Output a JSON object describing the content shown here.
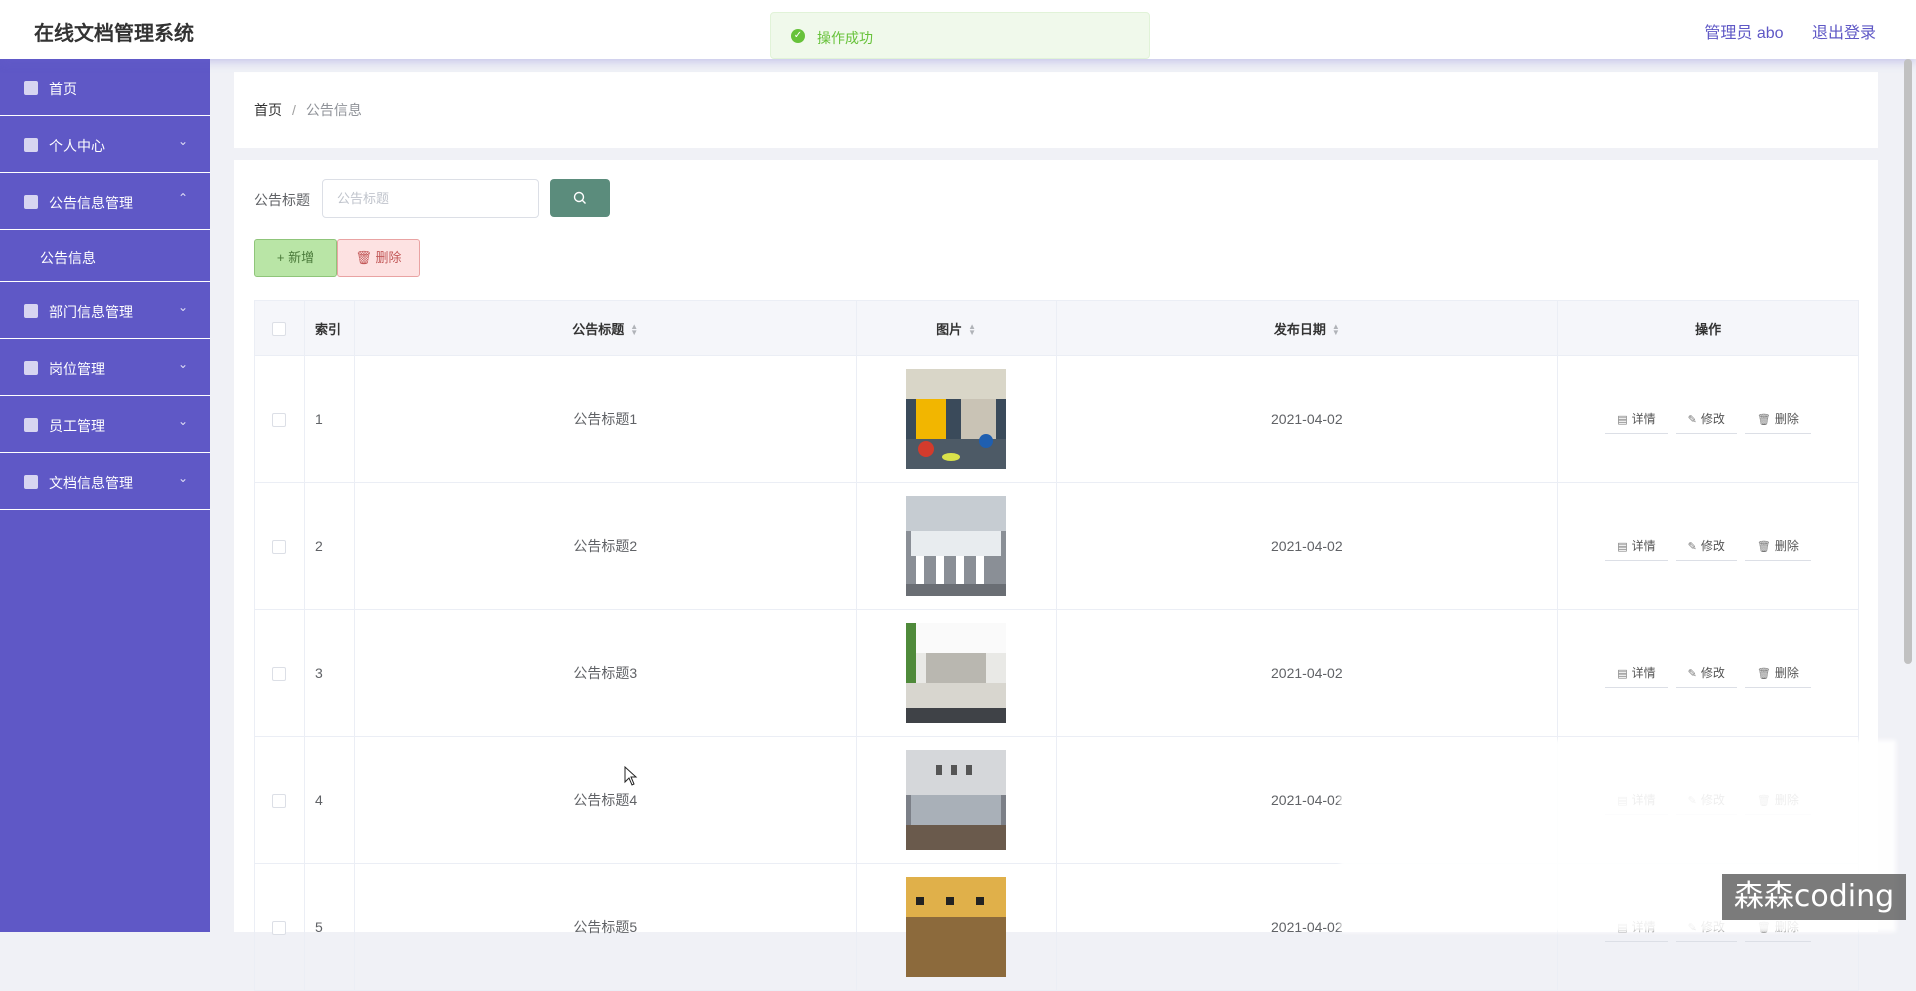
{
  "app": {
    "title": "在线文档管理系统"
  },
  "header": {
    "user_label": "管理员 abo",
    "logout_label": "退出登录"
  },
  "toast": {
    "message": "操作成功",
    "icon": "check-circle-icon",
    "color": "#67c23a"
  },
  "sidebar": {
    "items": [
      {
        "label": "首页",
        "icon": "home-icon"
      },
      {
        "label": "个人中心",
        "icon": "user-icon"
      },
      {
        "label": "公告信息管理",
        "icon": "chart-icon",
        "expanded": true,
        "children": [
          {
            "label": "公告信息"
          }
        ]
      },
      {
        "label": "部门信息管理",
        "icon": "clipboard-icon"
      },
      {
        "label": "岗位管理",
        "icon": "bar-icon"
      },
      {
        "label": "员工管理",
        "icon": "monitor-icon"
      },
      {
        "label": "文档信息管理",
        "icon": "clipboard-icon"
      }
    ],
    "bg_color": "#5f58c6"
  },
  "breadcrumb": {
    "home": "首页",
    "sep": "/",
    "current": "公告信息"
  },
  "search": {
    "label": "公告标题",
    "placeholder": "公告标题"
  },
  "toolbar": {
    "add_label": "+ 新增",
    "delete_label": "删除"
  },
  "table": {
    "headers": {
      "index": "索引",
      "title": "公告标题",
      "image": "图片",
      "date": "发布日期",
      "ops": "操作"
    },
    "ops_labels": {
      "detail": "详情",
      "edit": "修改",
      "delete": "删除"
    },
    "rows": [
      {
        "index": "1",
        "title": "公告标题1",
        "date": "2021-04-02"
      },
      {
        "index": "2",
        "title": "公告标题2",
        "date": "2021-04-02"
      },
      {
        "index": "3",
        "title": "公告标题3",
        "date": "2021-04-02"
      },
      {
        "index": "4",
        "title": "公告标题4",
        "date": "2021-04-02"
      },
      {
        "index": "5",
        "title": "公告标题5",
        "date": "2021-04-02"
      }
    ]
  },
  "watermark": {
    "text": "森森coding"
  }
}
